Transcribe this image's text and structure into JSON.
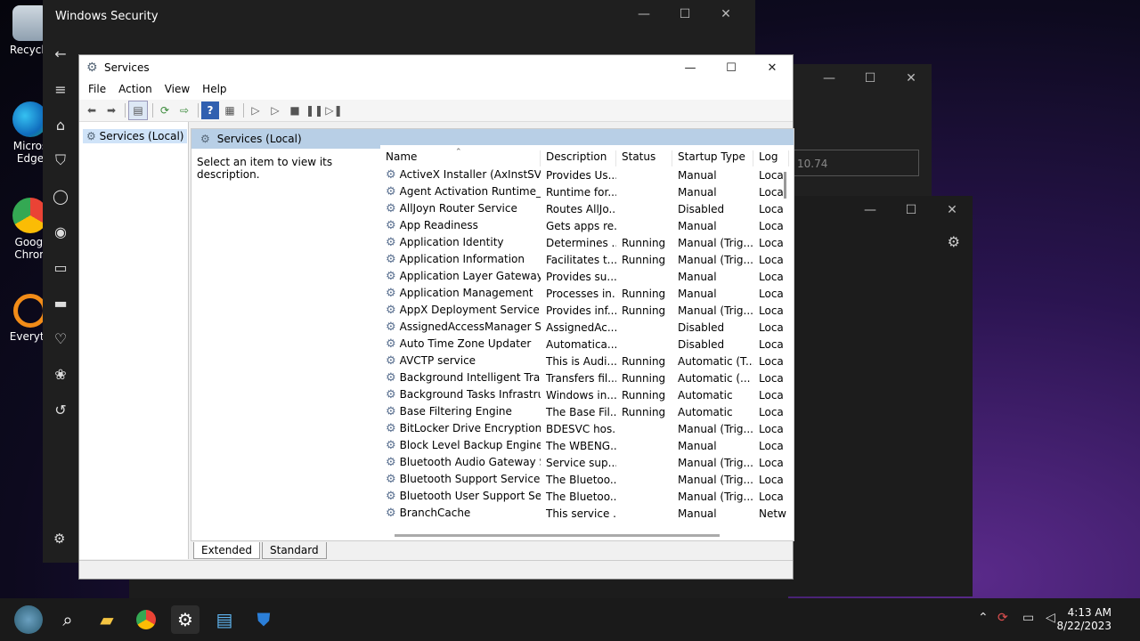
{
  "desktop": {
    "icons": [
      {
        "label": "Recycle",
        "icon": "recycle-bin-icon"
      },
      {
        "label": "Micros Edge",
        "icon": "edge-icon"
      },
      {
        "label": "Googl Chron",
        "icon": "chrome-icon"
      },
      {
        "label": "Everyth",
        "icon": "everything-search-icon"
      }
    ]
  },
  "background_windows": {
    "field_text": "10.74"
  },
  "windows_security": {
    "title": "Windows Security"
  },
  "services": {
    "title": "Services",
    "menu": [
      "File",
      "Action",
      "View",
      "Help"
    ],
    "tree_node": "Services (Local)",
    "pane_title": "Services (Local)",
    "description_hint": "Select an item to view its description.",
    "columns": [
      "Name",
      "Description",
      "Status",
      "Startup Type",
      "Log"
    ],
    "rows": [
      [
        "ActiveX Installer (AxInstSV)",
        "Provides Us...",
        "",
        "Manual",
        "Loca"
      ],
      [
        "Agent Activation Runtime_...",
        "Runtime for...",
        "",
        "Manual",
        "Loca"
      ],
      [
        "AllJoyn Router Service",
        "Routes AllJo...",
        "",
        "Disabled",
        "Loca"
      ],
      [
        "App Readiness",
        "Gets apps re...",
        "",
        "Manual",
        "Loca"
      ],
      [
        "Application Identity",
        "Determines ...",
        "Running",
        "Manual (Trig...",
        "Loca"
      ],
      [
        "Application Information",
        "Facilitates t...",
        "Running",
        "Manual (Trig...",
        "Loca"
      ],
      [
        "Application Layer Gateway ...",
        "Provides su...",
        "",
        "Manual",
        "Loca"
      ],
      [
        "Application Management",
        "Processes in...",
        "Running",
        "Manual",
        "Loca"
      ],
      [
        "AppX Deployment Service (...",
        "Provides inf...",
        "Running",
        "Manual (Trig...",
        "Loca"
      ],
      [
        "AssignedAccessManager Se...",
        "AssignedAc...",
        "",
        "Disabled",
        "Loca"
      ],
      [
        "Auto Time Zone Updater",
        "Automatica...",
        "",
        "Disabled",
        "Loca"
      ],
      [
        "AVCTP service",
        "This is Audi...",
        "Running",
        "Automatic (T...",
        "Loca"
      ],
      [
        "Background Intelligent Tran...",
        "Transfers fil...",
        "Running",
        "Automatic (...",
        "Loca"
      ],
      [
        "Background Tasks Infrastruc...",
        "Windows in...",
        "Running",
        "Automatic",
        "Loca"
      ],
      [
        "Base Filtering Engine",
        "The Base Fil...",
        "Running",
        "Automatic",
        "Loca"
      ],
      [
        "BitLocker Drive Encryption ...",
        "BDESVC hos...",
        "",
        "Manual (Trig...",
        "Loca"
      ],
      [
        "Block Level Backup Engine ...",
        "The WBENG...",
        "",
        "Manual",
        "Loca"
      ],
      [
        "Bluetooth Audio Gateway S...",
        "Service sup...",
        "",
        "Manual (Trig...",
        "Loca"
      ],
      [
        "Bluetooth Support Service",
        "The Bluetoo...",
        "",
        "Manual (Trig...",
        "Loca"
      ],
      [
        "Bluetooth User Support Ser...",
        "The Bluetoo...",
        "",
        "Manual (Trig...",
        "Loca"
      ],
      [
        "BranchCache",
        "This service ...",
        "",
        "Manual",
        "Netw"
      ]
    ],
    "tabs": [
      "Extended",
      "Standard"
    ]
  },
  "taskbar": {
    "time": "4:13 AM",
    "date": "8/22/2023"
  }
}
